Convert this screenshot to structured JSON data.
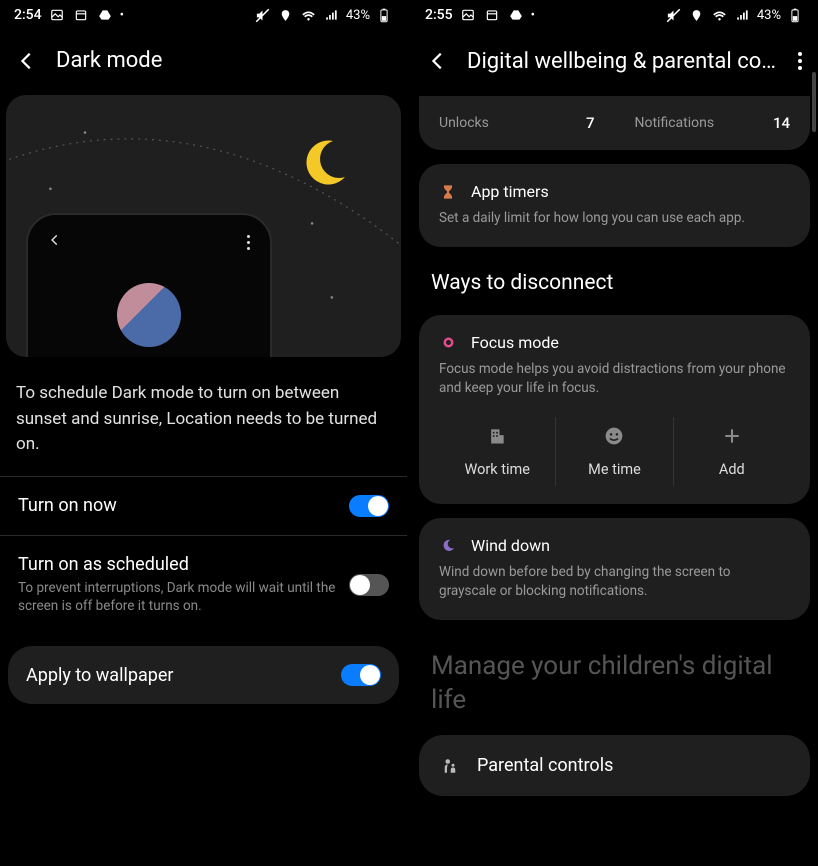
{
  "left": {
    "status": {
      "time": "2:54",
      "battery": "43%"
    },
    "header": {
      "title": "Dark mode"
    },
    "info": "To schedule Dark mode to turn on between sunset and sunrise, Location needs to be turned on.",
    "rows": {
      "turn_on_now": {
        "label": "Turn on now"
      },
      "schedule": {
        "label": "Turn on as scheduled",
        "sub": "To prevent interruptions, Dark mode will wait until the screen is off before it turns on."
      },
      "wallpaper": {
        "label": "Apply to wallpaper"
      }
    }
  },
  "right": {
    "status": {
      "time": "2:55",
      "battery": "43%"
    },
    "header": {
      "title": "Digital wellbeing & parental con..."
    },
    "stats": {
      "unlocks_label": "Unlocks",
      "unlocks_value": "7",
      "notifications_label": "Notifications",
      "notifications_value": "14"
    },
    "app_timers": {
      "title": "App timers",
      "desc": "Set a daily limit for how long you can use each app."
    },
    "section_ways": "Ways to disconnect",
    "focus": {
      "title": "Focus mode",
      "desc": "Focus mode helps you avoid distractions from your phone and keep your life in focus.",
      "actions": {
        "work": "Work time",
        "me": "Me time",
        "add": "Add"
      }
    },
    "wind": {
      "title": "Wind down",
      "desc": "Wind down before bed by changing the screen to grayscale or blocking notifications."
    },
    "manage": "Manage your children's digital life",
    "parental": {
      "title": "Parental controls"
    }
  }
}
